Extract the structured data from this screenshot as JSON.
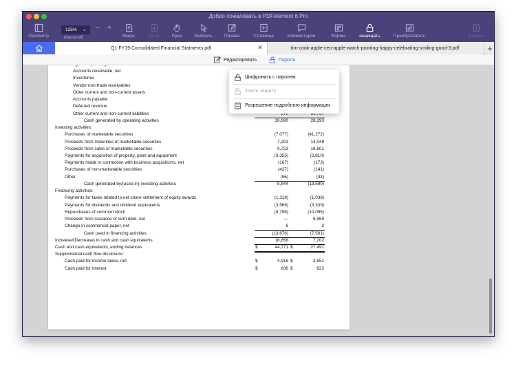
{
  "window": {
    "title": "Добро пожаловать в PDFelement 6 Pro"
  },
  "toolbar": {
    "zoom_value": "125%",
    "zoom_label": "Масштаб",
    "items": [
      {
        "label": "Просмотр",
        "icon": "view-icon"
      },
      {
        "label": "Вверх",
        "icon": "up-icon"
      },
      {
        "label": "Вниз",
        "icon": "down-icon"
      },
      {
        "label": "Рука",
        "icon": "hand-icon"
      },
      {
        "label": "Выбрать",
        "icon": "select-icon"
      },
      {
        "label": "Правка",
        "icon": "edit-icon"
      },
      {
        "label": "Страница",
        "icon": "page-icon"
      },
      {
        "label": "Комментарии",
        "icon": "comment-icon"
      },
      {
        "label": "Формы",
        "icon": "forms-icon"
      },
      {
        "label": "защищать",
        "icon": "lock-icon"
      },
      {
        "label": "Преобразовать",
        "icon": "convert-icon"
      },
      {
        "label": "Флажок",
        "icon": "flag-icon"
      }
    ]
  },
  "tabs": [
    {
      "label": "Q1 FY19 Consolidated Financial Statments.pdf"
    },
    {
      "label": "tim-cook-apple-ceo-apple-watch-pointing-happy-celebrating-smiling-good-3.pdf"
    }
  ],
  "subbar": {
    "edit_label": "Редактировать",
    "password_label": "Пароль"
  },
  "menu": {
    "encrypt_label": "Шифровать с паролем",
    "remove_label": "Снять защиту",
    "permissions_label": "Разрешение подробного информации"
  },
  "statement": {
    "rows": [
      {
        "label": "Changes in operating assets and liabilities:",
        "indent": 1,
        "v1": "",
        "v2": "",
        "cut": true
      },
      {
        "label": "Accounts receivable, net",
        "indent": 2,
        "v1": "",
        "v2": ""
      },
      {
        "label": "Inventories",
        "indent": 2,
        "v1": "",
        "v2": ""
      },
      {
        "label": "Vendor non-trade receivables",
        "indent": 2,
        "v1": "",
        "v2": ""
      },
      {
        "label": "Other current and non-current assets",
        "indent": 2,
        "v1": "",
        "v2": ""
      },
      {
        "label": "Accounts payable",
        "indent": 2,
        "v1": "",
        "v2": ""
      },
      {
        "label": "Deferred revenue",
        "indent": 2,
        "v1": "",
        "v2": ""
      },
      {
        "label": "Other current and non-current liabilities",
        "indent": 2,
        "v1": "570",
        "v2": "39,757"
      },
      {
        "label": "Cash generated by operating activities",
        "indent": 3,
        "v1": "26,690",
        "v2": "28,293",
        "ulineAbove": true
      },
      {
        "label": "Investing activities:",
        "indent": 0,
        "v1": "",
        "v2": ""
      },
      {
        "label": "Purchases of marketable securities",
        "indent": 1,
        "v1": "(7,077)",
        "v2": "(41,272)"
      },
      {
        "label": "Proceeds from maturities of marketable securities",
        "indent": 1,
        "v1": "7,203",
        "v2": "14,048"
      },
      {
        "label": "Proceeds from sales of marketable securities",
        "indent": 1,
        "v1": "9,723",
        "v2": "16,801"
      },
      {
        "label": "Payments for acquisition of property, plant and equipment",
        "indent": 1,
        "v1": "(3,355)",
        "v2": "(2,810)"
      },
      {
        "label": "Payments made in connection with business acquisitions, net",
        "indent": 1,
        "v1": "(167)",
        "v2": "(173)"
      },
      {
        "label": "Purchases of non-marketable securities",
        "indent": 1,
        "v1": "(427)",
        "v2": "(141)"
      },
      {
        "label": "Other",
        "indent": 1,
        "v1": "(56)",
        "v2": "(43)"
      },
      {
        "label": "Cash generated by/(used in) investing activities",
        "indent": 3,
        "v1": "5,844",
        "v2": "(13,590)",
        "ulineAbove": true
      },
      {
        "label": "Financing activities:",
        "indent": 0,
        "v1": "",
        "v2": ""
      },
      {
        "label": "Payments for taxes related to net share settlement of equity awards",
        "indent": 1,
        "v1": "(1,318)",
        "v2": "(1,038)"
      },
      {
        "label": "Payments for dividends and dividend equivalents",
        "indent": 1,
        "v1": "(3,568)",
        "v2": "(3,339)"
      },
      {
        "label": "Repurchases of common stock",
        "indent": 1,
        "v1": "(8,796)",
        "v2": "(10,095)"
      },
      {
        "label": "Proceeds from issuance of term debt, net",
        "indent": 1,
        "v1": "—",
        "v2": "6,969"
      },
      {
        "label": "Change in commercial paper, net",
        "indent": 1,
        "v1": "6",
        "v2": "2"
      },
      {
        "label": "Cash used in financing activities",
        "indent": 3,
        "v1": "(13,676)",
        "v2": "(7,501)",
        "ulineAbove": true
      },
      {
        "label": "Increase/(Decrease) in cash and cash equivalents",
        "indent": 0,
        "v1": "18,858",
        "v2": "7,202",
        "ulineAbove": true
      },
      {
        "label": "Cash and cash equivalents, ending balances",
        "indent": 0,
        "v1": "44,771",
        "v2": "27,491",
        "dollar": true,
        "ulineAbove": true,
        "double": true
      },
      {
        "label": "Supplemental cash flow disclosure:",
        "indent": 0,
        "v1": "",
        "v2": ""
      },
      {
        "label": "Cash paid for income taxes, net",
        "indent": 1,
        "v1": "4,916",
        "v2": "3,551",
        "dollar": true
      },
      {
        "label": "Cash paid for interest",
        "indent": 1,
        "v1": "836",
        "v2": "623",
        "dollar": true
      }
    ],
    "currency_symbol": "$"
  }
}
